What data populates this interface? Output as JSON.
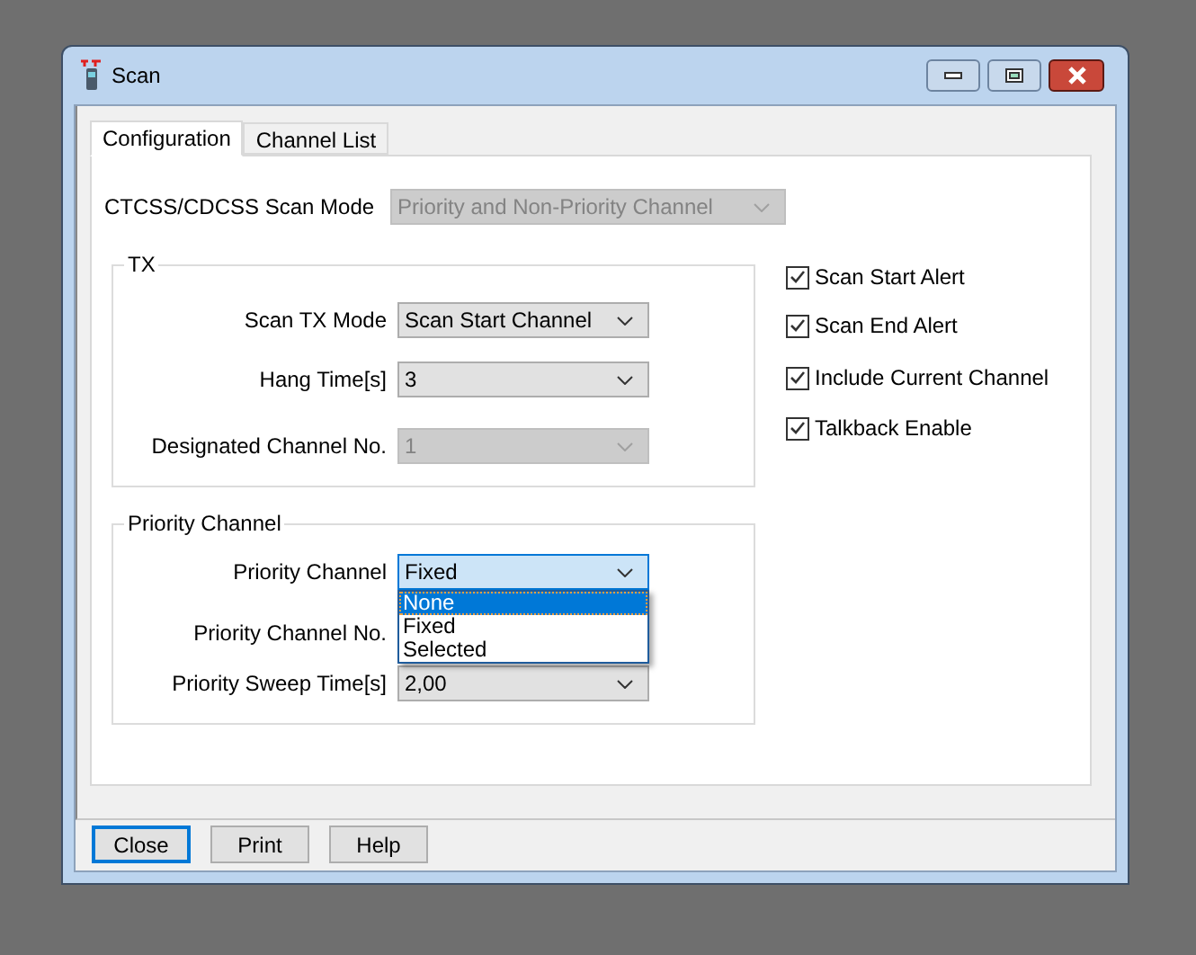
{
  "window": {
    "title": "Scan"
  },
  "tabs": [
    {
      "label": "Configuration",
      "selected": true
    },
    {
      "label": "Channel List",
      "selected": false
    }
  ],
  "scan_mode": {
    "label": "CTCSS/CDCSS Scan Mode",
    "value": "Priority and Non-Priority Channel",
    "disabled": true
  },
  "tx_group": {
    "title": "TX",
    "fields": [
      {
        "label": "Scan TX Mode",
        "value": "Scan Start Channel",
        "disabled": false,
        "expanded": false
      },
      {
        "label": "Hang Time[s]",
        "value": "3",
        "disabled": false,
        "expanded": false
      },
      {
        "label": "Designated Channel No.",
        "value": "1",
        "disabled": true,
        "expanded": false
      }
    ]
  },
  "priority_group": {
    "title": "Priority Channel",
    "fields": [
      {
        "label": "Priority Channel",
        "value": "Fixed",
        "disabled": false,
        "expanded": true,
        "options": [
          {
            "label": "None",
            "highlighted": true
          },
          {
            "label": "Fixed",
            "highlighted": false
          },
          {
            "label": "Selected",
            "highlighted": false
          }
        ]
      },
      {
        "label": "Priority Channel No."
      },
      {
        "label": "Priority Sweep Time[s]",
        "value": "2,00",
        "disabled": false,
        "expanded": false
      }
    ]
  },
  "checkboxes": [
    {
      "label": "Scan Start Alert",
      "checked": true
    },
    {
      "label": "Scan End Alert",
      "checked": true
    },
    {
      "label": "Include Current Channel",
      "checked": true
    },
    {
      "label": "Talkback Enable",
      "checked": true
    }
  ],
  "buttons": [
    {
      "label": "Close",
      "default": true
    },
    {
      "label": "Print",
      "default": false
    },
    {
      "label": "Help",
      "default": false
    }
  ]
}
